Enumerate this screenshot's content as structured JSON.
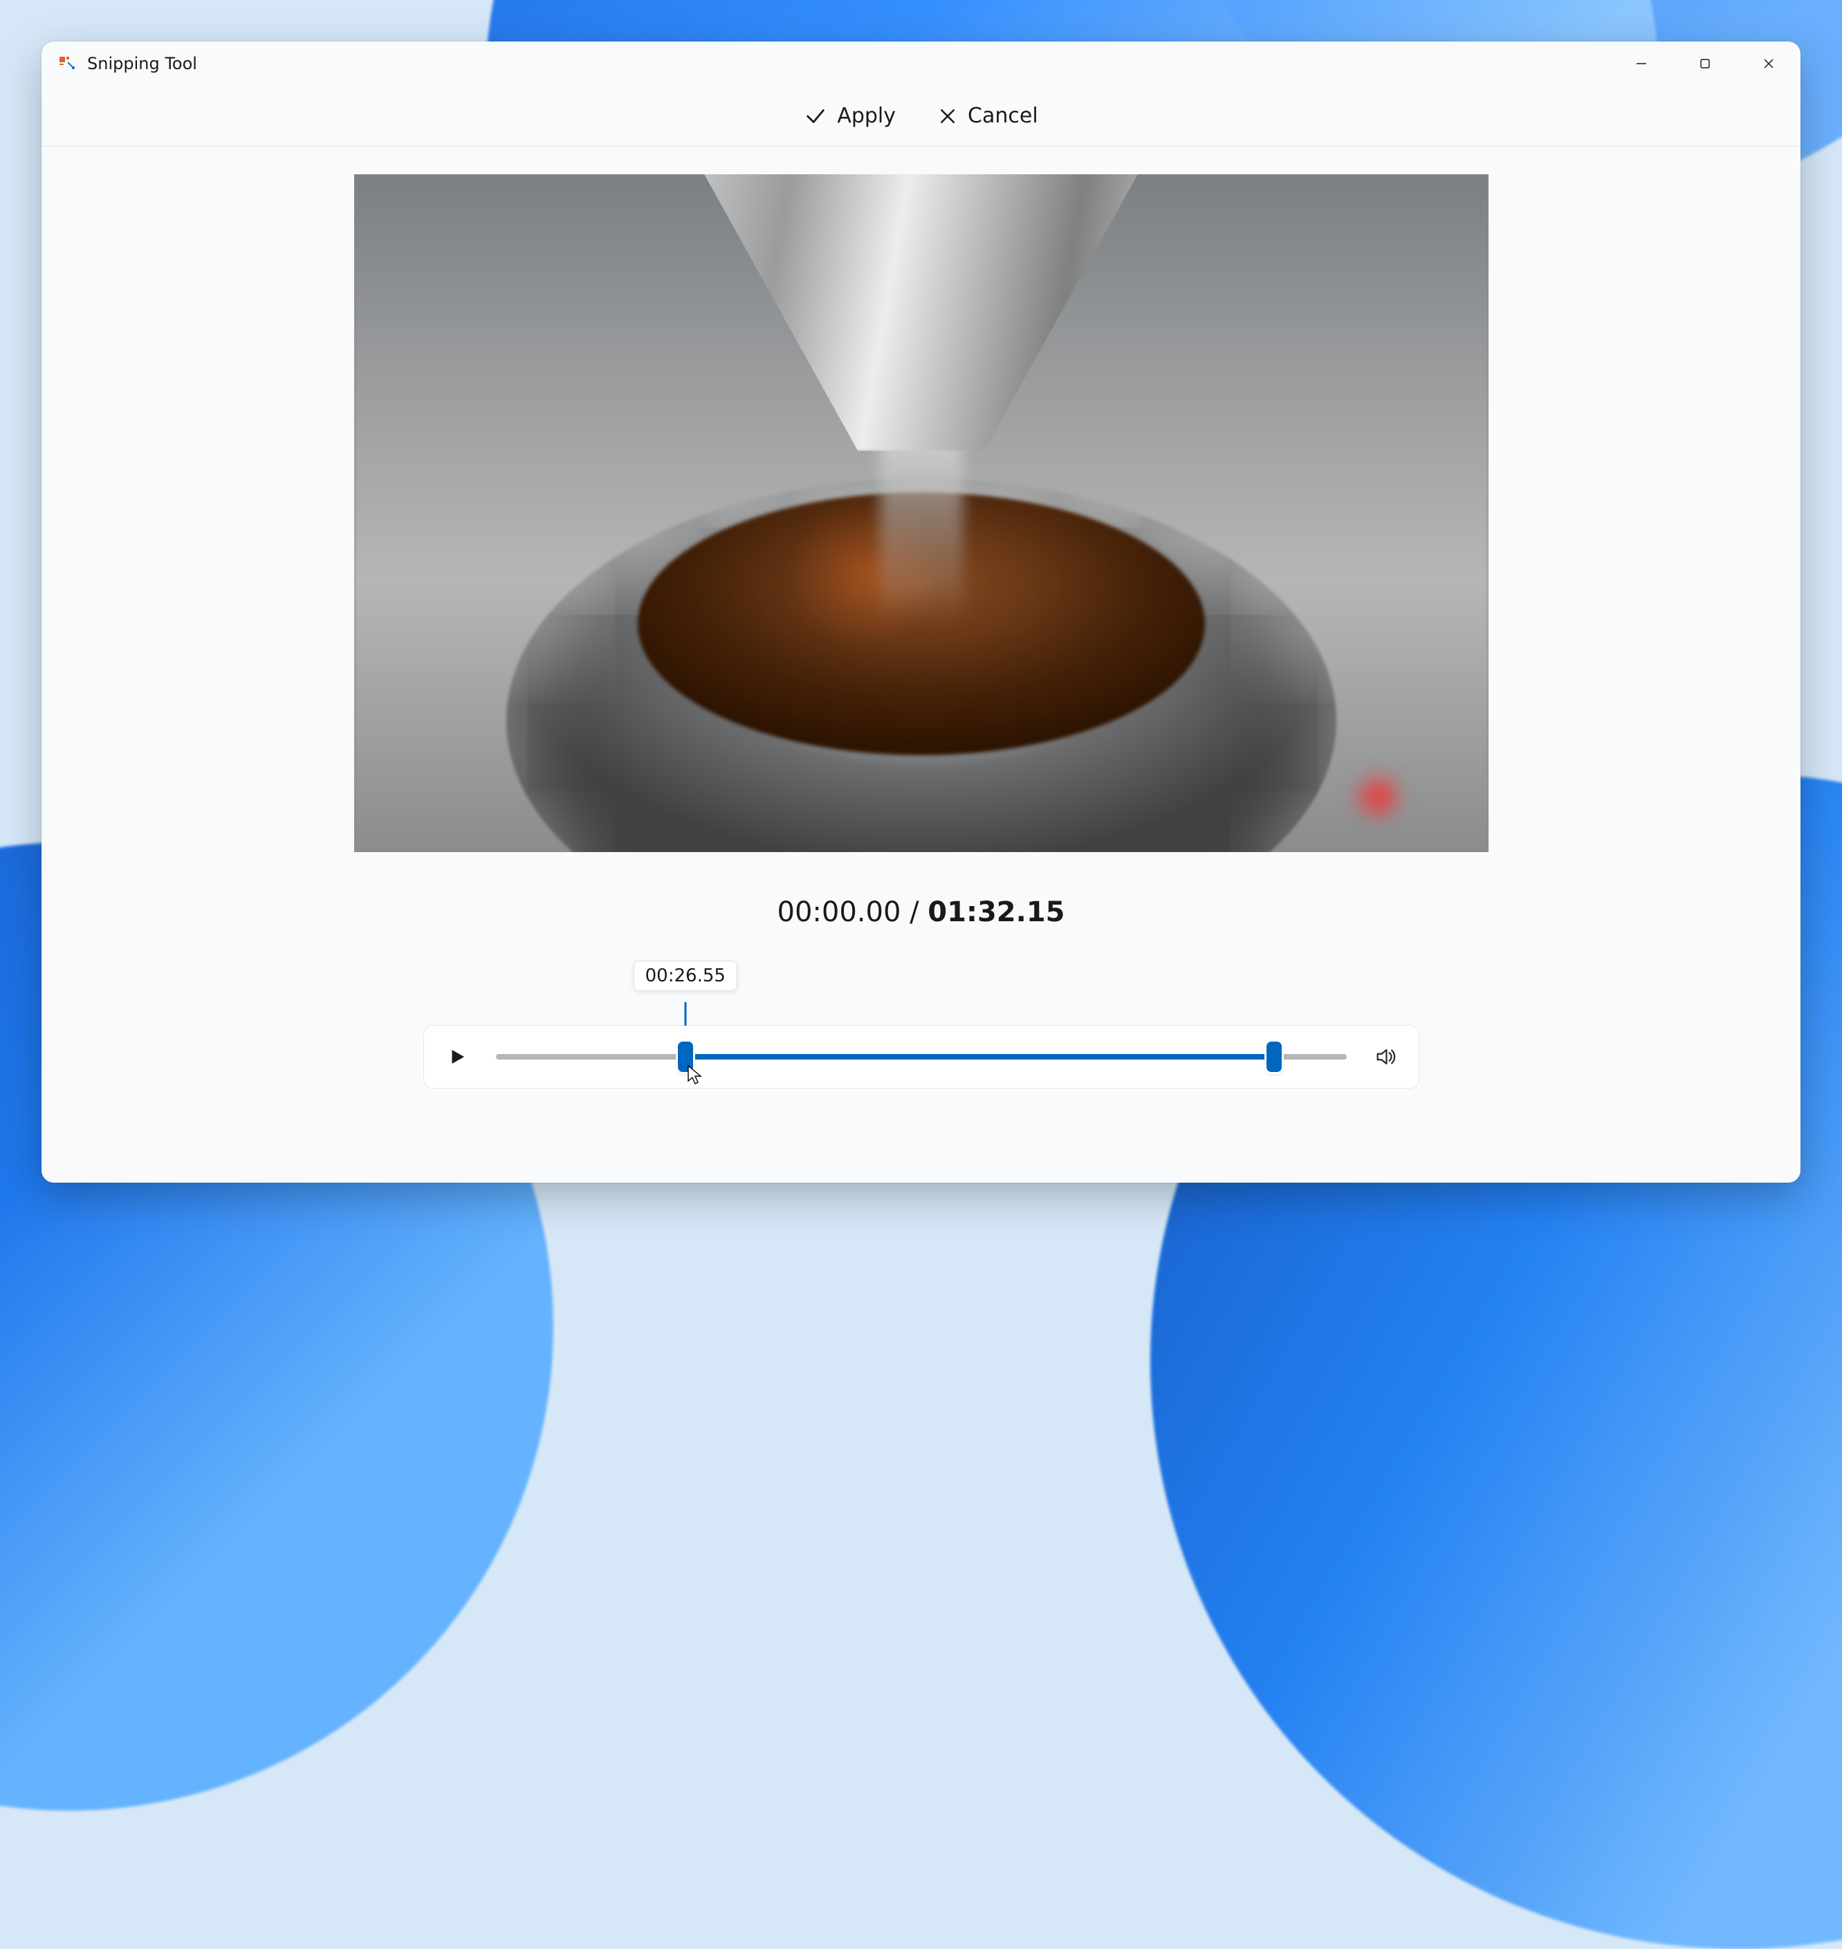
{
  "window": {
    "title": "Snipping Tool"
  },
  "toolbar": {
    "apply_label": "Apply",
    "cancel_label": "Cancel"
  },
  "playback": {
    "current_time": "00:00.00",
    "separator": " / ",
    "total_time": "01:32.15"
  },
  "trim": {
    "tooltip_time": "00:26.55",
    "start_percent": 22.3,
    "end_percent": 91.5
  },
  "icons": {
    "apply": "check-icon",
    "cancel": "x-icon",
    "minimize": "minimize-icon",
    "maximize": "maximize-icon",
    "close": "close-icon",
    "play": "play-icon",
    "volume": "volume-icon"
  }
}
